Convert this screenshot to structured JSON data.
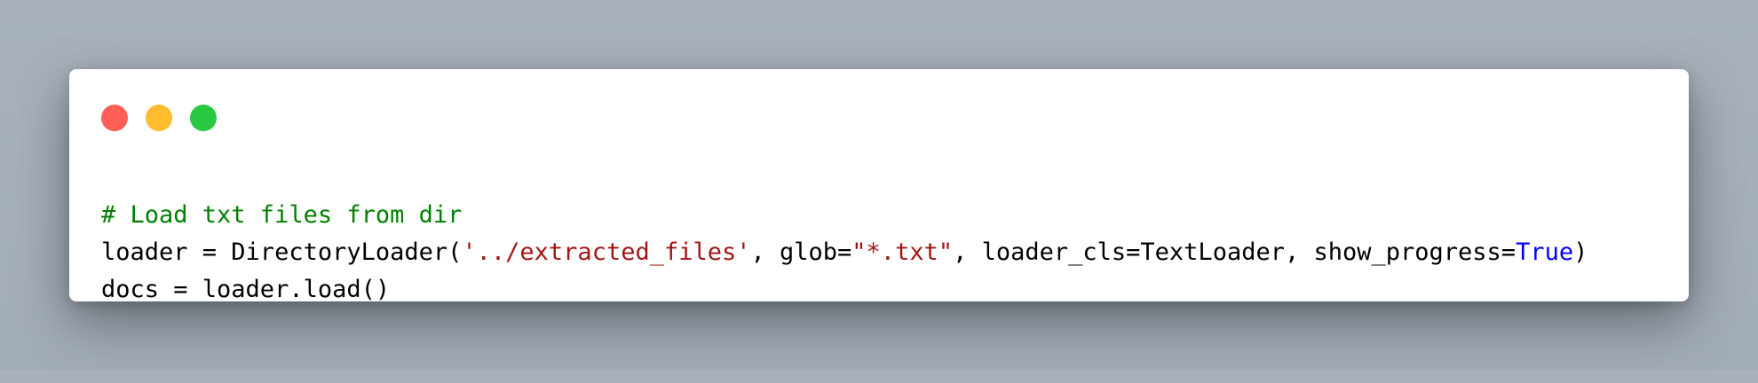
{
  "window": {
    "controls": [
      {
        "name": "close",
        "color": "#ff5f57"
      },
      {
        "name": "minimize",
        "color": "#febc2e"
      },
      {
        "name": "maximize",
        "color": "#28c840"
      }
    ]
  },
  "code": {
    "colors": {
      "comment": "#008000",
      "default": "#000000",
      "string": "#a31515",
      "keyword": "#0000ff"
    },
    "lines": [
      {
        "tokens": [
          {
            "text": "# Load txt files from dir",
            "type": "comment"
          }
        ]
      },
      {
        "tokens": [
          {
            "text": "loader = DirectoryLoader(",
            "type": "default"
          },
          {
            "text": "'../extracted_files'",
            "type": "string"
          },
          {
            "text": ", glob=",
            "type": "default"
          },
          {
            "text": "\"*.txt\"",
            "type": "string"
          },
          {
            "text": ", loader_cls=TextLoader, show_progress=",
            "type": "default"
          },
          {
            "text": "True",
            "type": "keyword"
          },
          {
            "text": ")",
            "type": "default"
          }
        ]
      },
      {
        "tokens": [
          {
            "text": "docs = loader.load()",
            "type": "default"
          }
        ]
      }
    ]
  }
}
